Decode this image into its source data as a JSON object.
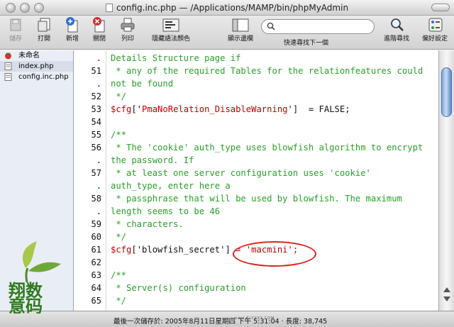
{
  "window": {
    "file": "config.inc.php",
    "separator": "—",
    "path": "/Applications/MAMP/bin/phpMyAdmin"
  },
  "toolbar": {
    "save": "儲存",
    "open": "打開",
    "new": "新增",
    "close": "關閉",
    "print": "列印",
    "hide_syntax": "隱藏語法顏色",
    "show_side": "顯示邊欄",
    "quick_find": "快速尋找下一個",
    "advanced_find": "進階尋找",
    "prefs": "偏好設定"
  },
  "files": [
    {
      "name": "未命名"
    },
    {
      "name": "index.php"
    },
    {
      "name": "config.inc.php"
    }
  ],
  "gutter": [
    ".",
    "51",
    ".",
    "52",
    "53",
    "54",
    "55",
    "56",
    ".",
    "57",
    ".",
    "58",
    ".",
    "59",
    "60",
    "61",
    "62",
    "63",
    "64",
    "65"
  ],
  "code": [
    "Details Structure page if",
    " * any of the required Tables for the relationfeatures could",
    "not be found",
    " */",
    "",
    "",
    "/**",
    " * The 'cookie' auth_type uses blowfish algorithm to encrypt",
    "the password. If",
    " * at least one server configuration uses 'cookie'",
    "auth_type, enter here a",
    " * passphrase that will be used by blowfish. The maximum",
    "length seems to be 46",
    " * characters.",
    " */",
    "",
    "",
    "/**",
    " * Server(s) configuration",
    " */"
  ],
  "line53": {
    "var": "$cfg",
    "open": "['",
    "key": "PmaNoRelation_DisableWarning",
    "close": "']",
    "rest": "  = FALSE;"
  },
  "line61": {
    "var": "$cfg",
    "open": "['",
    "key": "blowfish_secret",
    "close": "']",
    "rest": " = 'macmini';"
  },
  "status": "最後一次儲存於: 2005年8月11日星期四 下午 5:31:04 · 長度: 38,745",
  "watermark": {
    "text": "翔数意码",
    "url": "www.FLYXKY.COM"
  },
  "colors": {
    "comment": "#2aa02a",
    "keyword": "#c00000",
    "highlight_circle": "#e0201a"
  }
}
